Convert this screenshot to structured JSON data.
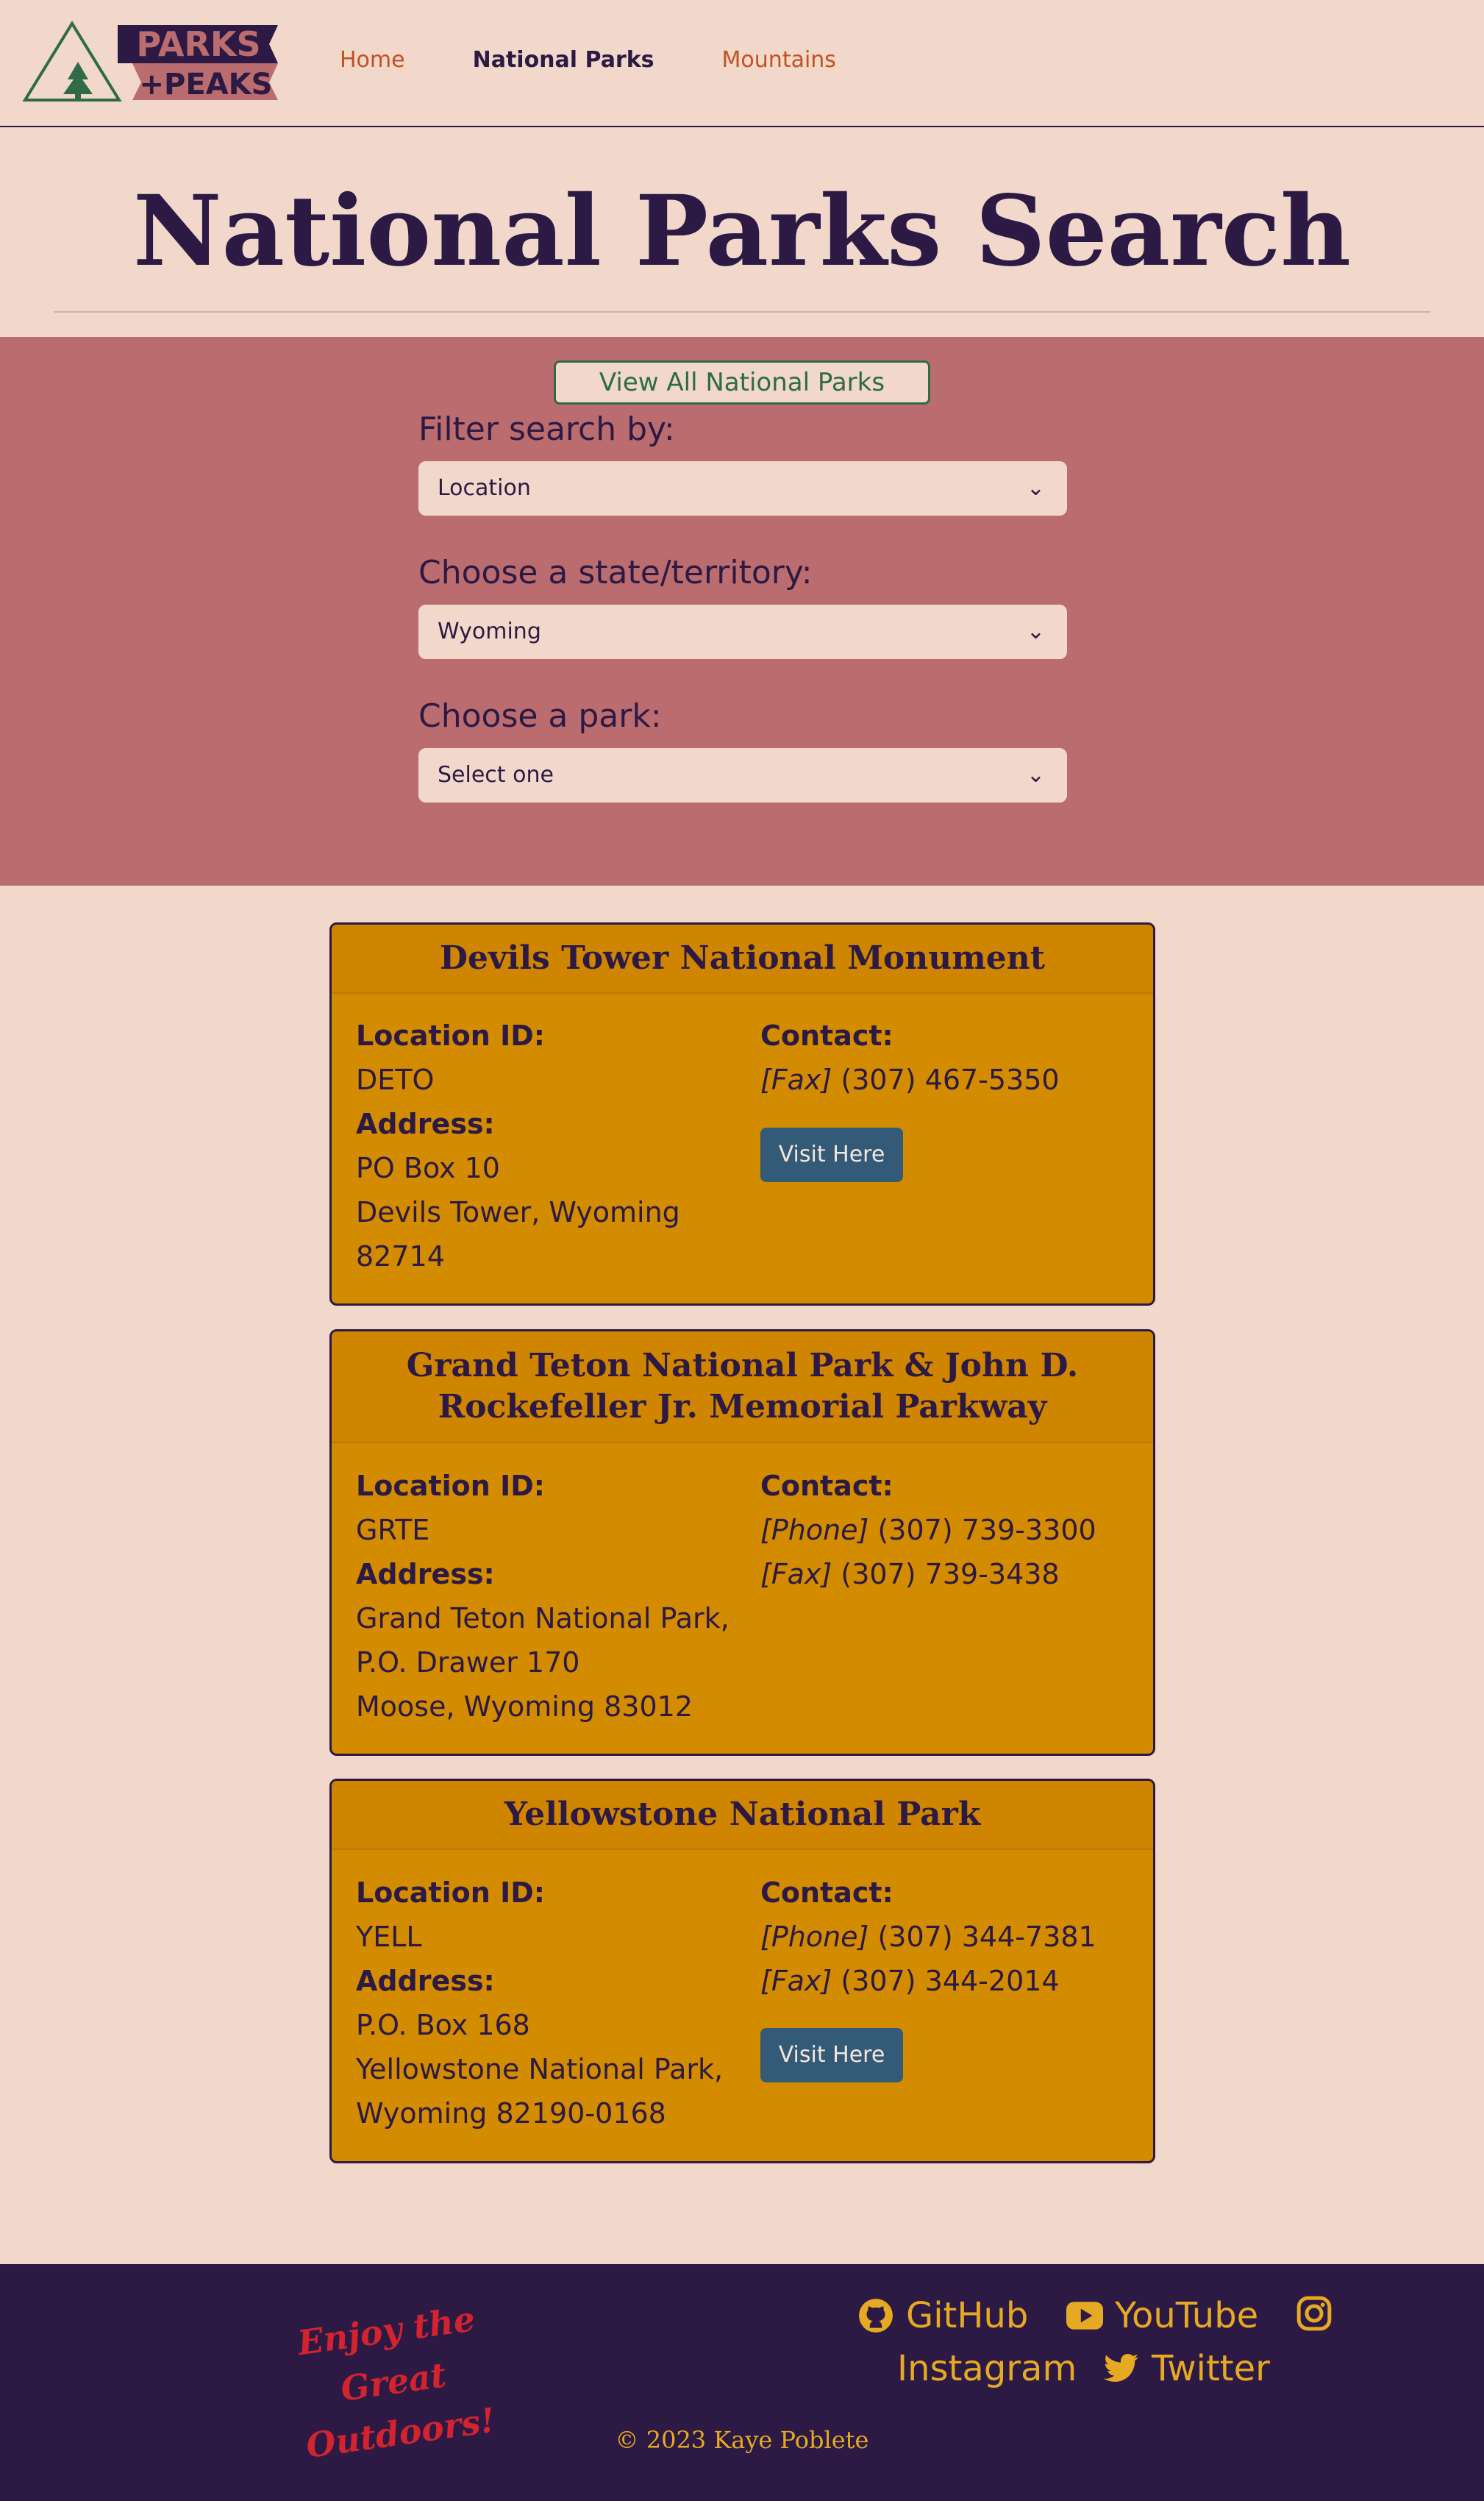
{
  "brand": {
    "logo_top": "PARKS",
    "logo_bottom": "+PEAKS"
  },
  "nav": {
    "home": "Home",
    "national_parks": "National Parks",
    "mountains": "Mountains"
  },
  "page_title": "National Parks Search",
  "filters": {
    "view_all": "View All National Parks",
    "filter_by_label": "Filter search by:",
    "filter_by_value": "Location",
    "state_label": "Choose a state/territory:",
    "state_value": "Wyoming",
    "park_label": "Choose a park:",
    "park_value": "Select one"
  },
  "labels": {
    "location_id": "Location ID:",
    "address": "Address:",
    "contact": "Contact:",
    "visit": "Visit Here"
  },
  "parks": [
    {
      "name": "Devils Tower National Monument",
      "location_id": "DETO",
      "address_lines": [
        "PO Box 10",
        "Devils Tower, Wyoming",
        "82714"
      ],
      "contacts": [
        {
          "type": "[Fax]",
          "number": "(307) 467-5350"
        }
      ]
    },
    {
      "name": "Grand Teton National Park & John D. Rockefeller Jr. Memorial Parkway",
      "location_id": "GRTE",
      "address_lines": [
        "Grand Teton National Park,",
        "P.O. Drawer 170",
        "Moose, Wyoming 83012"
      ],
      "contacts": [
        {
          "type": "[Phone]",
          "number": "(307) 739-3300"
        },
        {
          "type": "[Fax]",
          "number": "(307) 739-3438"
        }
      ]
    },
    {
      "name": "Yellowstone National Park",
      "location_id": "YELL",
      "address_lines": [
        "P.O. Box 168",
        "Yellowstone National Park,",
        "Wyoming 82190-0168"
      ],
      "contacts": [
        {
          "type": "[Phone]",
          "number": "(307) 344-7381"
        },
        {
          "type": "[Fax]",
          "number": "(307) 344-2014"
        }
      ]
    }
  ],
  "footer": {
    "tagline_1": "Enjoy the",
    "tagline_2": "Great Outdoors!",
    "github": "GitHub",
    "youtube": "YouTube",
    "instagram": "Instagram",
    "twitter": "Twitter",
    "copyright": "© 2023 Kaye Poblete"
  },
  "colors": {
    "background": "#f1d8ca",
    "accent_band": "#bb6c6f",
    "card": "#d38b00",
    "dark": "#2c1a45",
    "button": "#335a76",
    "footer_text": "#e6a923",
    "tagline": "#d2232f",
    "nav_link": "#c15222"
  }
}
